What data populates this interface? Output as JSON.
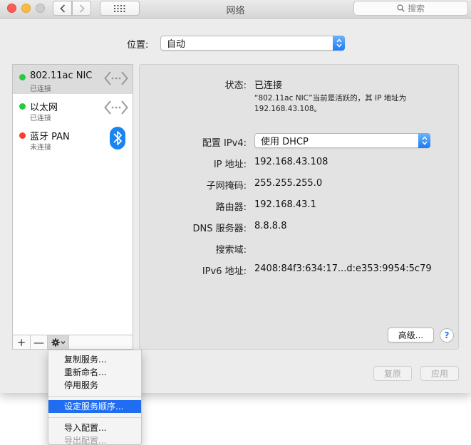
{
  "window": {
    "title": "网络"
  },
  "search": {
    "placeholder": "搜索"
  },
  "location": {
    "label": "位置:",
    "value": "自动"
  },
  "services": [
    {
      "name": "802.11ac NIC",
      "status": "已连接",
      "dot_color": "#28c840",
      "icon": "wifi-arrows-icon",
      "selected": true
    },
    {
      "name": "以太网",
      "status": "已连接",
      "dot_color": "#28c840",
      "icon": "ethernet-arrows-icon",
      "selected": false
    },
    {
      "name": "蓝牙 PAN",
      "status": "未连接",
      "dot_color": "#ff3b30",
      "icon": "bluetooth-icon",
      "selected": false
    }
  ],
  "toolbar": {
    "add": "+",
    "remove": "—"
  },
  "detail": {
    "status_label": "状态:",
    "status_value": "已连接",
    "status_desc": "“802.11ac NIC”当前是活跃的，其 IP 地址为 192.168.43.108。",
    "config_label": "配置 IPv4:",
    "config_value": "使用 DHCP",
    "ip_label": "IP 地址:",
    "ip_value": "192.168.43.108",
    "mask_label": "子网掩码:",
    "mask_value": "255.255.255.0",
    "router_label": "路由器:",
    "router_value": "192.168.43.1",
    "dns_label": "DNS 服务器:",
    "dns_value": "8.8.8.8",
    "search_domain_label": "搜索域:",
    "search_domain_value": "",
    "ipv6_label": "IPv6 地址:",
    "ipv6_value": "2408:84f3:634:17...d:e353:9954:5c79",
    "advanced_label": "高级...",
    "help_label": "?"
  },
  "footer": {
    "revert_label": "复原",
    "apply_label": "应用"
  },
  "menu": {
    "items": [
      {
        "label": "复制服务...",
        "state": "normal"
      },
      {
        "label": "重新命名...",
        "state": "normal"
      },
      {
        "label": "停用服务",
        "state": "normal"
      },
      {
        "label": "设定服务顺序...",
        "state": "highlighted"
      },
      {
        "label": "导入配置...",
        "state": "normal"
      },
      {
        "label": "导出配置...",
        "state": "disabled"
      }
    ]
  },
  "colors": {
    "accent": "#1f6ef2",
    "connected": "#28c840",
    "disconnected": "#ff3b30"
  }
}
